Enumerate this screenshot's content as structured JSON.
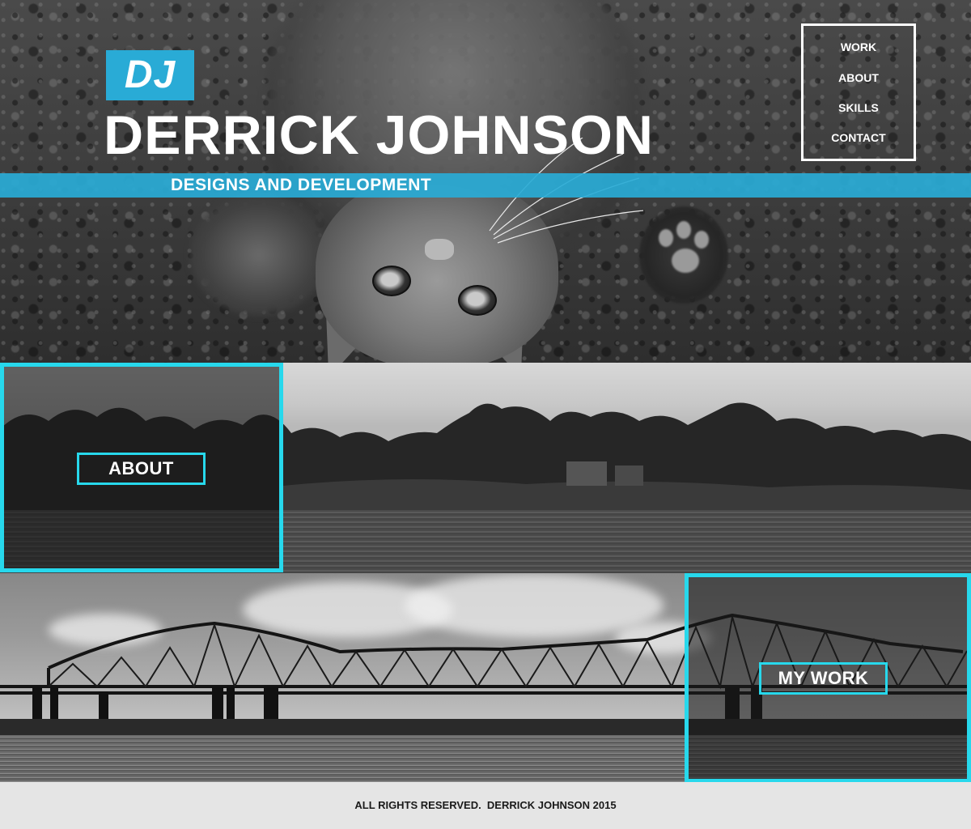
{
  "header": {
    "logo_initials": "DJ",
    "name": "DERRICK JOHNSON",
    "tagline": "DESIGNS AND DEVELOPMENT"
  },
  "nav": {
    "items": [
      {
        "label": "WORK"
      },
      {
        "label": "ABOUT"
      },
      {
        "label": "SKILLS"
      },
      {
        "label": "CONTACT"
      }
    ]
  },
  "sections": {
    "about_label": "ABOUT",
    "work_label": "MY WORK"
  },
  "footer": {
    "text": "ALL RIGHTS RESERVED.  DERRICK JOHNSON 2015"
  },
  "colors": {
    "accent_blue": "#29abd6",
    "accent_cyan": "#27d8ec",
    "footer_bg": "#e5e5e5"
  }
}
